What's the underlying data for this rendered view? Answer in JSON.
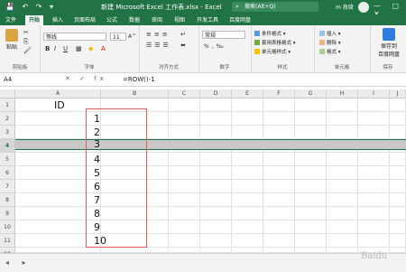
{
  "titlebar": {
    "quick_access": "💾 ↶ ↷ ▾",
    "title": "新建 Microsoft Excel 工作表.xlsx  -  Excel",
    "search_placeholder": "搜索(Alt+Q)",
    "user": "m 孜琦",
    "window_controls": "— ▢ ✕"
  },
  "tabs": [
    "文件",
    "开始",
    "插入",
    "页面布局",
    "公式",
    "数据",
    "审阅",
    "视图",
    "开发工具",
    "百度网盘"
  ],
  "active_tab": "开始",
  "ribbon": {
    "clipboard": {
      "paste": "粘贴",
      "label": "剪贴板"
    },
    "font": {
      "name": "等线",
      "size": "11",
      "label": "字体",
      "bold": "B",
      "italic": "I",
      "underline": "U",
      "grow": "A^",
      "shrink": "Aˇ"
    },
    "alignment": {
      "label": "对齐方式"
    },
    "number": {
      "format": "常规",
      "label": "数字"
    },
    "styles": {
      "items": [
        "条件格式 ▾",
        "套用表格格式 ▾",
        "单元格样式 ▾"
      ],
      "label": "样式"
    },
    "cells": {
      "items": [
        "插入 ▾",
        "删除 ▾",
        "格式 ▾"
      ],
      "label": "单元格"
    },
    "baidu": {
      "btn1": "保存到",
      "btn2": "百度网盘",
      "label": "保存"
    }
  },
  "formula_bar": {
    "name_box": "A4",
    "fx": "✕ ✓ fx",
    "formula": "=ROW()-1"
  },
  "columns": [
    "A",
    "B",
    "C",
    "D",
    "E",
    "F",
    "G",
    "H",
    "I",
    "J"
  ],
  "rows": [
    "1",
    "2",
    "3",
    "4",
    "5",
    "6",
    "7",
    "8",
    "9",
    "10",
    "11",
    "12"
  ],
  "sheet": {
    "header_A1": "ID",
    "values": [
      "1",
      "2",
      "3",
      "4",
      "5",
      "6",
      "7",
      "8",
      "9",
      "10"
    ]
  },
  "watermark": "Baidu"
}
